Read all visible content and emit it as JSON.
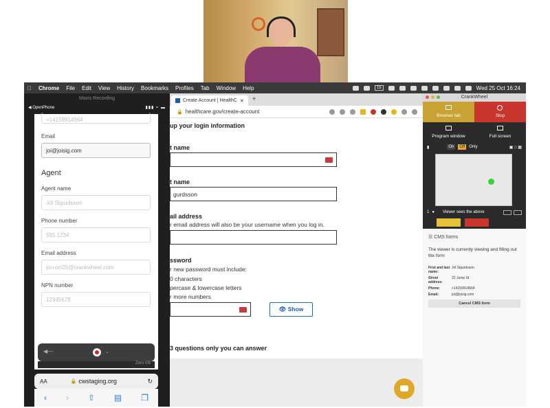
{
  "menubar": {
    "app": "Chrome",
    "items": [
      "File",
      "Edit",
      "View",
      "History",
      "Bookmarks",
      "Profiles",
      "Tab",
      "Window",
      "Help"
    ],
    "battery": "15",
    "clock": "Wed 25 Oct  16:24"
  },
  "phone": {
    "recording_title": "Mavis Recording",
    "status_left": "OpenPhone",
    "prev_value": "+14159914564",
    "email_label": "Email",
    "email_value": "joi@joisig.com",
    "agent_heading": "Agent",
    "agent_name_label": "Agent name",
    "agent_name_placeholder": "Jói Sigurdsson",
    "phone_label": "Phone number",
    "phone_placeholder": "555 1234",
    "email2_label": "Email address",
    "email2_placeholder": "joi+oct25@crankwheel.com",
    "npn_label": "NPN number",
    "npn_placeholder": "12345678",
    "rec_size": "Zero KB",
    "url": "cwstaging.org",
    "url_prefix": "AA"
  },
  "browser": {
    "tab_title": "Create Account | HealthC",
    "url": "healthcare.gov/create-account",
    "heading": "up your login information",
    "first_name_label": "t name",
    "last_name_label": "t name",
    "last_name_value": "gurdsson",
    "email_label": "ail address",
    "email_hint": "r email address will also be your username when you log in.",
    "password_label": "ssword",
    "pw_rules_intro": "r new password must include:",
    "pw_rule1": "0 characters",
    "pw_rule2": "percase & lowercase letters",
    "pw_rule3": "r more numbers",
    "show_button": "Show",
    "security_heading": "3 questions only you can answer"
  },
  "crankwheel": {
    "title": "CrankWheel",
    "browser_tab": "Browser tab",
    "stop": "Stop",
    "program_window": "Program window",
    "full_screen": "Full screen",
    "toggle_on": "On",
    "toggle_off": "Off",
    "toggle_only": "Only",
    "viewer_count": "1",
    "viewer_text": "Viewer sees the above",
    "cms_heading": "CMS forms",
    "cms_message": "The viewer is currently viewing and filling out the form",
    "rows": [
      {
        "k": "First and last name:",
        "v": "Jói Sigurdsson"
      },
      {
        "k": "Street address:",
        "v": "22 Jump St"
      },
      {
        "k": "Phone:",
        "v": "+14159914564"
      },
      {
        "k": "Email:",
        "v": "joi@joisig.com"
      }
    ],
    "cancel": "Cancel CMS form"
  },
  "colors": {
    "stop_red": "#c8362e",
    "yellow": "#e6c23a",
    "link_blue": "#1a5fa8"
  }
}
